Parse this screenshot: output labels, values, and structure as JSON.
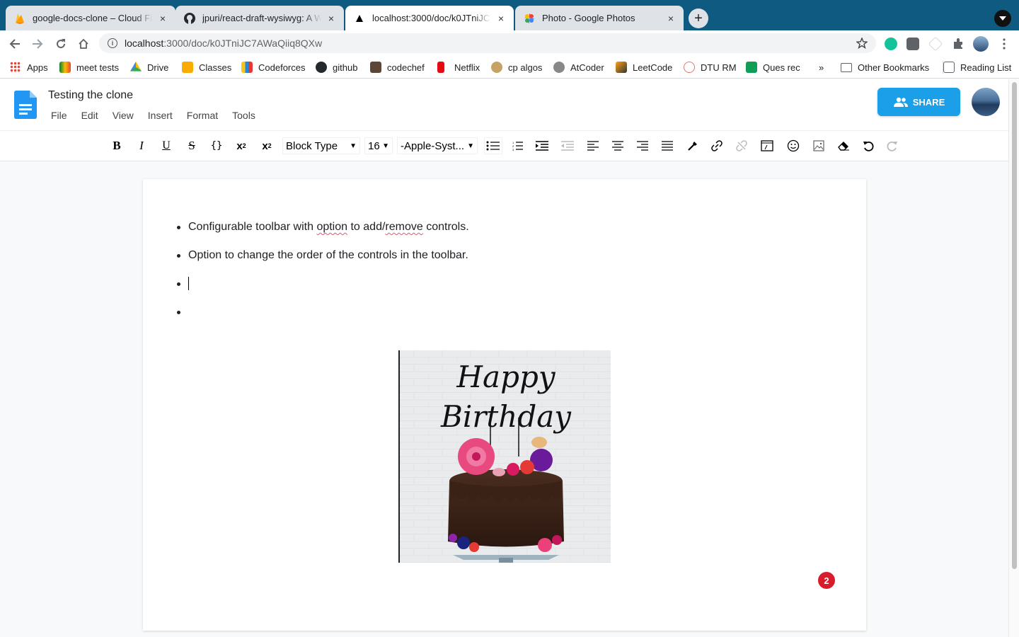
{
  "browser": {
    "tabs": [
      {
        "title": "google-docs-clone – Cloud Fir",
        "close": "×"
      },
      {
        "title": "jpuri/react-draft-wysiwyg: A W",
        "close": "×"
      },
      {
        "title": "localhost:3000/doc/k0JTniJC7A",
        "close": "×"
      },
      {
        "title": "Photo - Google Photos",
        "close": "×"
      }
    ],
    "new_tab": "+",
    "url_host": "localhost",
    "url_path": ":3000/doc/k0JTniJC7AWaQiiq8QXw",
    "bookmarks": [
      "Apps",
      "meet tests",
      "Drive",
      "Classes",
      "Codeforces",
      "github",
      "codechef",
      "Netflix",
      "cp algos",
      "AtCoder",
      "LeetCode",
      "DTU RM",
      "Ques rec"
    ],
    "overflow": "»",
    "other_bookmarks": "Other Bookmarks",
    "reading_list": "Reading List"
  },
  "app": {
    "doc_title": "Testing the clone",
    "menus": [
      "File",
      "Edit",
      "View",
      "Insert",
      "Format",
      "Tools"
    ],
    "share_label": "SHARE"
  },
  "editor_toolbar": {
    "block_type": "Block Type",
    "font_size": "16",
    "font_family": "-Apple-Syst..."
  },
  "document": {
    "bullets": [
      {
        "before": "Configurable toolbar with ",
        "sp1": "option",
        "mid": " to add/",
        "sp2": "remove",
        "after": " controls."
      },
      {
        "text": "Option to change the order of the controls in the toolbar."
      }
    ],
    "image_caption_line1": "Happy",
    "image_caption_line2": "Birthday"
  },
  "notification_count": "2",
  "colors": {
    "share": "#1a9fe8",
    "badge": "#d91c2b",
    "tabstrip": "#0f5a80"
  }
}
